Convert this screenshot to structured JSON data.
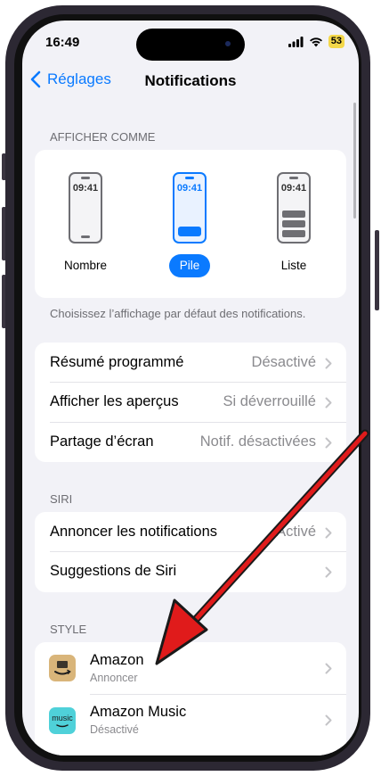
{
  "status": {
    "time": "16:49",
    "battery": "53"
  },
  "nav": {
    "back_label": "Réglages",
    "title": "Notifications"
  },
  "display_as": {
    "header": "AFFICHER COMME",
    "options": [
      {
        "label": "Nombre",
        "time": "09:41",
        "selected": false
      },
      {
        "label": "Pile",
        "time": "09:41",
        "selected": true
      },
      {
        "label": "Liste",
        "time": "09:41",
        "selected": false
      }
    ],
    "footer": "Choisissez l’affichage par défaut des notifications."
  },
  "general": [
    {
      "label": "Résumé programmé",
      "value": "Désactivé"
    },
    {
      "label": "Afficher les aperçus",
      "value": "Si déverrouillé"
    },
    {
      "label": "Partage d’écran",
      "value": "Notif. désactivées"
    }
  ],
  "siri": {
    "header": "SIRI",
    "rows": [
      {
        "label": "Annoncer les notifications",
        "value": "Activé"
      },
      {
        "label": "Suggestions de Siri",
        "value": ""
      }
    ]
  },
  "style": {
    "header": "STYLE",
    "apps": [
      {
        "name": "Amazon",
        "subtitle": "Annoncer",
        "icon": "amazon-app-icon",
        "color": "#d9b57a"
      },
      {
        "name": "Amazon Music",
        "subtitle": "Désactivé",
        "icon": "amazon-music-app-icon",
        "color": "#4fd1d9",
        "icon_text": "music"
      }
    ]
  },
  "annotation": {
    "color": "#e01b1b"
  }
}
